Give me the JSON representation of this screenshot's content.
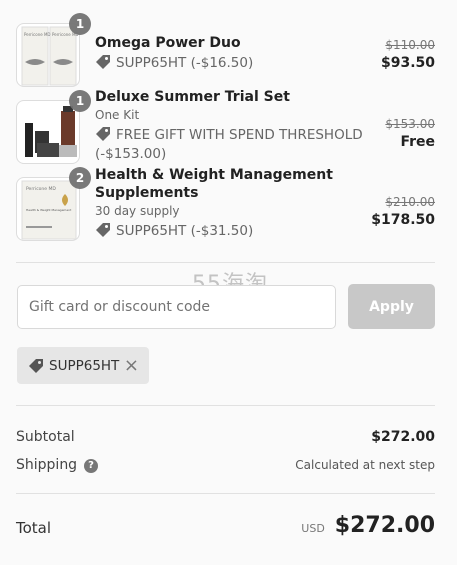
{
  "items": [
    {
      "qty": "1",
      "name": "Omega Power Duo",
      "variant": "",
      "discount": "SUPP65HT (-$16.50)",
      "old_price": "$110.00",
      "price": "$93.50",
      "thumb_text": "Perricone MD"
    },
    {
      "qty": "1",
      "name": "Deluxe Summer Trial Set",
      "variant": "One Kit",
      "discount_line1": "FREE GIFT WITH SPEND THRESHOLD",
      "discount_line2": "(-$153.00)",
      "old_price": "$153.00",
      "price": "Free"
    },
    {
      "qty": "2",
      "name_line1": "Health & Weight Management",
      "name_line2": "Supplements",
      "variant": "30 day supply",
      "discount": "SUPP65HT (-$31.50)",
      "old_price": "$210.00",
      "price": "$178.50",
      "thumb_text": "Perricone MD",
      "thumb_sub": "Health & Weight Management"
    }
  ],
  "discount_form": {
    "placeholder": "Gift card or discount code",
    "apply_label": "Apply"
  },
  "applied_code": "SUPP65HT",
  "subtotal": {
    "label": "Subtotal",
    "value": "$272.00"
  },
  "shipping": {
    "label": "Shipping",
    "value": "Calculated at next step"
  },
  "total": {
    "label": "Total",
    "currency": "USD",
    "value": "$272.00"
  },
  "watermark": "55海淘",
  "colors": {
    "apply_bg": "#c8c8c8",
    "chip_bg": "#e6e6e6",
    "badge_bg": "#727272"
  },
  "icons": [
    "discount-tag-icon",
    "help-icon",
    "close-icon"
  ]
}
